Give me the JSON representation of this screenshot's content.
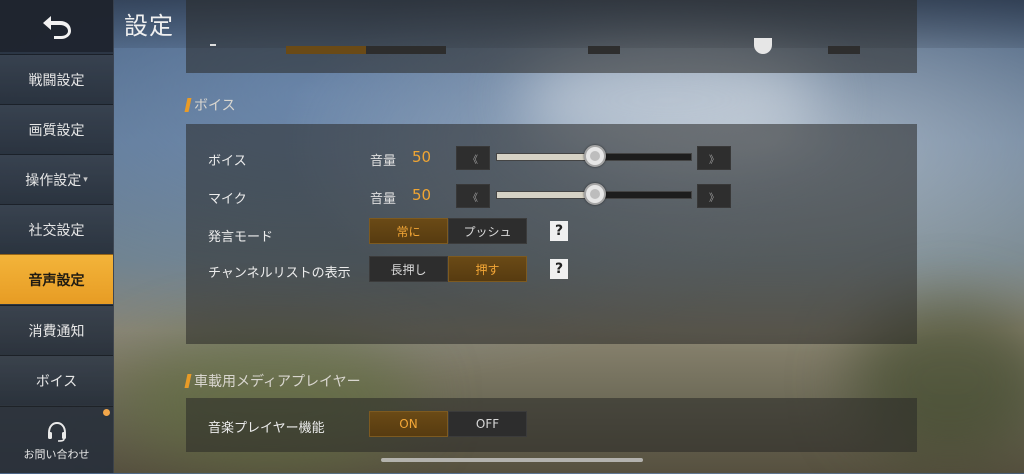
{
  "page_title": "設定",
  "sidebar": {
    "back_icon": "back-arrow-icon",
    "items": [
      {
        "label": "戦闘設定"
      },
      {
        "label": "画質設定"
      },
      {
        "label": "操作設定",
        "caret": "▾"
      },
      {
        "label": "社交設定"
      },
      {
        "label": "音声設定",
        "active": true
      },
      {
        "label": "消費通知"
      },
      {
        "label": "ボイス"
      }
    ],
    "contact": {
      "label": "お問い合わせ",
      "icon": "headset-icon",
      "badge_color": "#f2a64a"
    }
  },
  "voice_section": {
    "title": "ボイス",
    "rows": {
      "voice": {
        "label": "ボイス",
        "volume_label": "音量",
        "value": "50",
        "level_percent": 50
      },
      "mic": {
        "label": "マイク",
        "volume_label": "音量",
        "value": "50",
        "level_percent": 50
      },
      "speak_mode": {
        "label": "発言モード",
        "options": [
          "常に",
          "プッシュ"
        ],
        "selected": "常に"
      },
      "channel_list": {
        "label": "チャンネルリストの表示",
        "options": [
          "長押し",
          "押す"
        ],
        "selected": "押す"
      }
    },
    "help_glyph": "?"
  },
  "media_section": {
    "title": "車載用メディアプレイヤー",
    "music_player": {
      "label": "音楽プレイヤー機能",
      "options": [
        "ON",
        "OFF"
      ],
      "selected": "ON"
    }
  },
  "colors": {
    "accent": "#f0a533",
    "active_tab": "#f3b43a"
  }
}
